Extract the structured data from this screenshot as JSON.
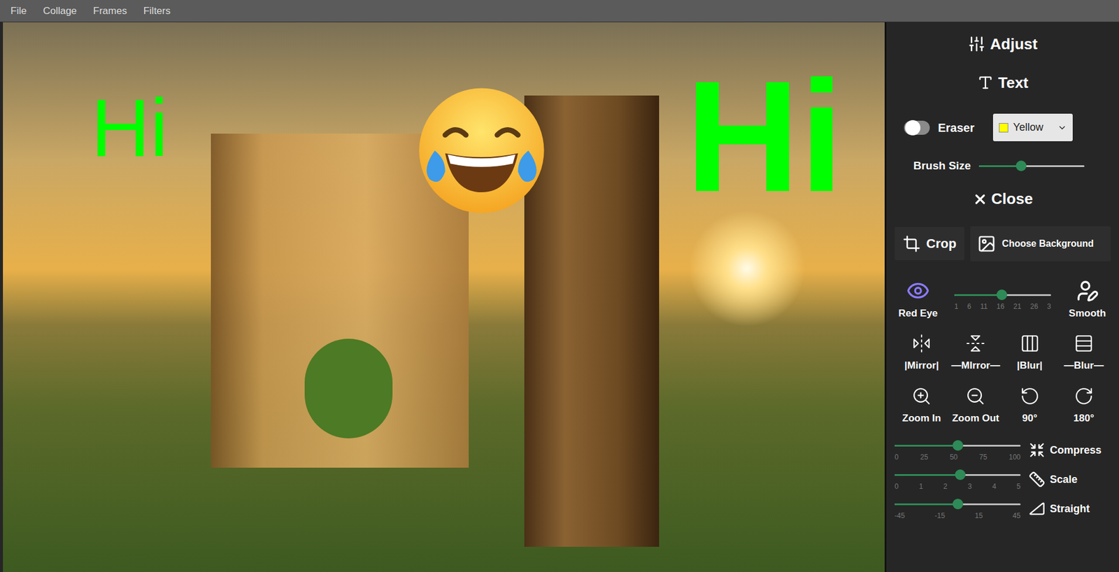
{
  "menu": [
    "File",
    "Collage",
    "Frames",
    "Filters"
  ],
  "canvas": {
    "overlays": [
      {
        "text": "Hi",
        "kind": "typed",
        "color": "#00ff00"
      },
      {
        "text": "Hi",
        "kind": "brush",
        "color": "#00ff00"
      }
    ]
  },
  "panel": {
    "adjust": "Adjust",
    "text": "Text",
    "eraser": {
      "label": "Eraser",
      "on": false
    },
    "color_picker": {
      "label": "Yellow",
      "color": "#ffff00"
    },
    "brush_size": {
      "label": "Brush Size",
      "level": 0.4
    },
    "close": "Close",
    "crop": "Crop",
    "background": "Choose Background",
    "red_eye": "Red Eye",
    "smooth": {
      "label": "Smooth",
      "level": 0.49,
      "ticks": [
        "1",
        "6",
        "11",
        "16",
        "21",
        "26",
        "3"
      ]
    },
    "tools": [
      "|Mirror|",
      "—MIrror—",
      "|Blur|",
      "—Blur—",
      "Zoom In",
      "Zoom Out",
      "90°",
      "180°"
    ],
    "sliders": [
      {
        "label": "Compress",
        "level": 0.5,
        "ticks": [
          "0",
          "25",
          "50",
          "75",
          "100"
        ]
      },
      {
        "label": "Scale",
        "level": 0.52,
        "ticks": [
          "0",
          "1",
          "2",
          "3",
          "4",
          "5"
        ]
      },
      {
        "label": "Straight",
        "level": 0.5,
        "ticks": [
          "-45",
          "-15",
          "15",
          "45"
        ]
      }
    ]
  }
}
